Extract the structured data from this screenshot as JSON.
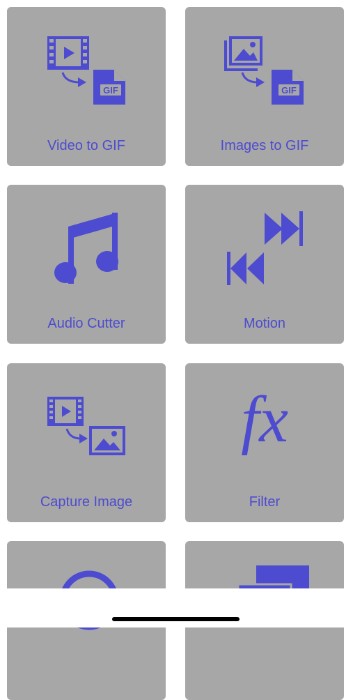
{
  "accent_color": "#4d4bcf",
  "tile_color": "#a7a7a7",
  "tiles": [
    {
      "label": "Video to GIF",
      "icon": "video-to-gif-icon",
      "badge": "GIF"
    },
    {
      "label": "Images to GIF",
      "icon": "images-to-gif-icon",
      "badge": "GIF"
    },
    {
      "label": "Audio Cutter",
      "icon": "music-note-icon"
    },
    {
      "label": "Motion",
      "icon": "fast-forward-rewind-icon"
    },
    {
      "label": "Capture Image",
      "icon": "video-to-image-icon"
    },
    {
      "label": "Filter",
      "icon": "fx-icon",
      "glyph": "fx"
    },
    {
      "label": "",
      "icon": "circle-icon"
    },
    {
      "label": "",
      "icon": "stacked-windows-icon"
    }
  ],
  "home_indicator": "home-indicator"
}
